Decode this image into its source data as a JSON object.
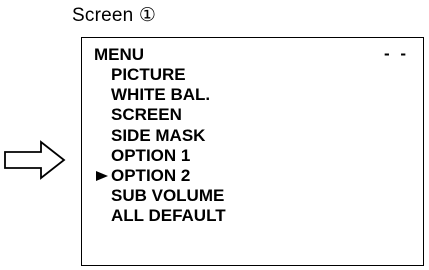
{
  "screen_label": "Screen ①",
  "pointer_icon": "right-arrow-outline-icon",
  "menu": {
    "title": "MENU",
    "status": "- -",
    "selected_index": 5,
    "items": [
      {
        "label": "PICTURE"
      },
      {
        "label": "WHITE BAL."
      },
      {
        "label": "SCREEN"
      },
      {
        "label": "SIDE MASK"
      },
      {
        "label": "OPTION 1"
      },
      {
        "label": "OPTION 2"
      },
      {
        "label": "SUB VOLUME"
      },
      {
        "label": "ALL DEFAULT"
      }
    ]
  }
}
